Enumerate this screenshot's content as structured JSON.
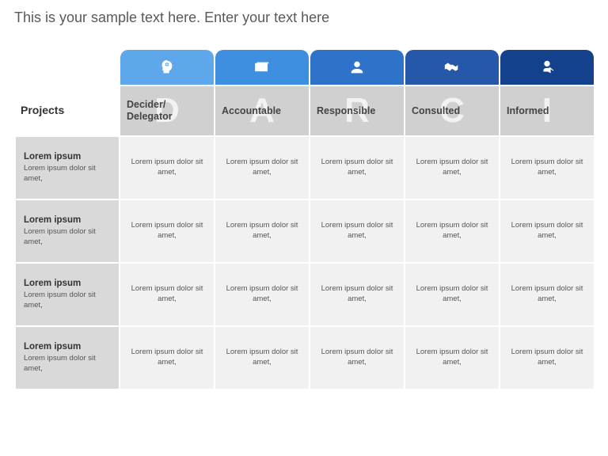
{
  "title": "This is your sample text here. Enter your text here",
  "table": {
    "projects_header": "Projects",
    "columns": [
      {
        "watermark": "D",
        "label": "Decider/\nDelegator",
        "color": "#5ea7ea",
        "icon": "head-gear"
      },
      {
        "watermark": "A",
        "label": "Accountable",
        "color": "#3f8fe0",
        "icon": "money"
      },
      {
        "watermark": "R",
        "label": "Responsible",
        "color": "#2e72c9",
        "icon": "person"
      },
      {
        "watermark": "C",
        "label": "Consulted",
        "color": "#2558a8",
        "icon": "handshake"
      },
      {
        "watermark": "I",
        "label": "Informed",
        "color": "#14418c",
        "icon": "megaphone"
      }
    ],
    "rows": [
      {
        "project_title": "Lorem ipsum",
        "project_sub": "Lorem ipsum dolor sit amet,",
        "cells": [
          "Lorem ipsum dolor sit amet,",
          "Lorem ipsum dolor sit amet,",
          "Lorem ipsum dolor sit amet,",
          "Lorem ipsum dolor sit amet,",
          "Lorem ipsum dolor sit amet,"
        ]
      },
      {
        "project_title": "Lorem ipsum",
        "project_sub": "Lorem ipsum dolor sit amet,",
        "cells": [
          "Lorem ipsum dolor sit amet,",
          "Lorem ipsum dolor sit amet,",
          "Lorem ipsum dolor sit amet,",
          "Lorem ipsum dolor sit amet,",
          "Lorem ipsum dolor sit amet,"
        ]
      },
      {
        "project_title": "Lorem ipsum",
        "project_sub": "Lorem ipsum dolor sit amet,",
        "cells": [
          "Lorem ipsum dolor sit amet,",
          "Lorem ipsum dolor sit amet,",
          "Lorem ipsum dolor sit amet,",
          "Lorem ipsum dolor sit amet,",
          "Lorem ipsum dolor sit amet,"
        ]
      },
      {
        "project_title": "Lorem ipsum",
        "project_sub": "Lorem ipsum dolor sit amet,",
        "cells": [
          "Lorem ipsum dolor sit amet,",
          "Lorem ipsum dolor sit amet,",
          "Lorem ipsum dolor sit amet,",
          "Lorem ipsum dolor sit amet,",
          "Lorem ipsum dolor sit amet,"
        ]
      }
    ]
  }
}
